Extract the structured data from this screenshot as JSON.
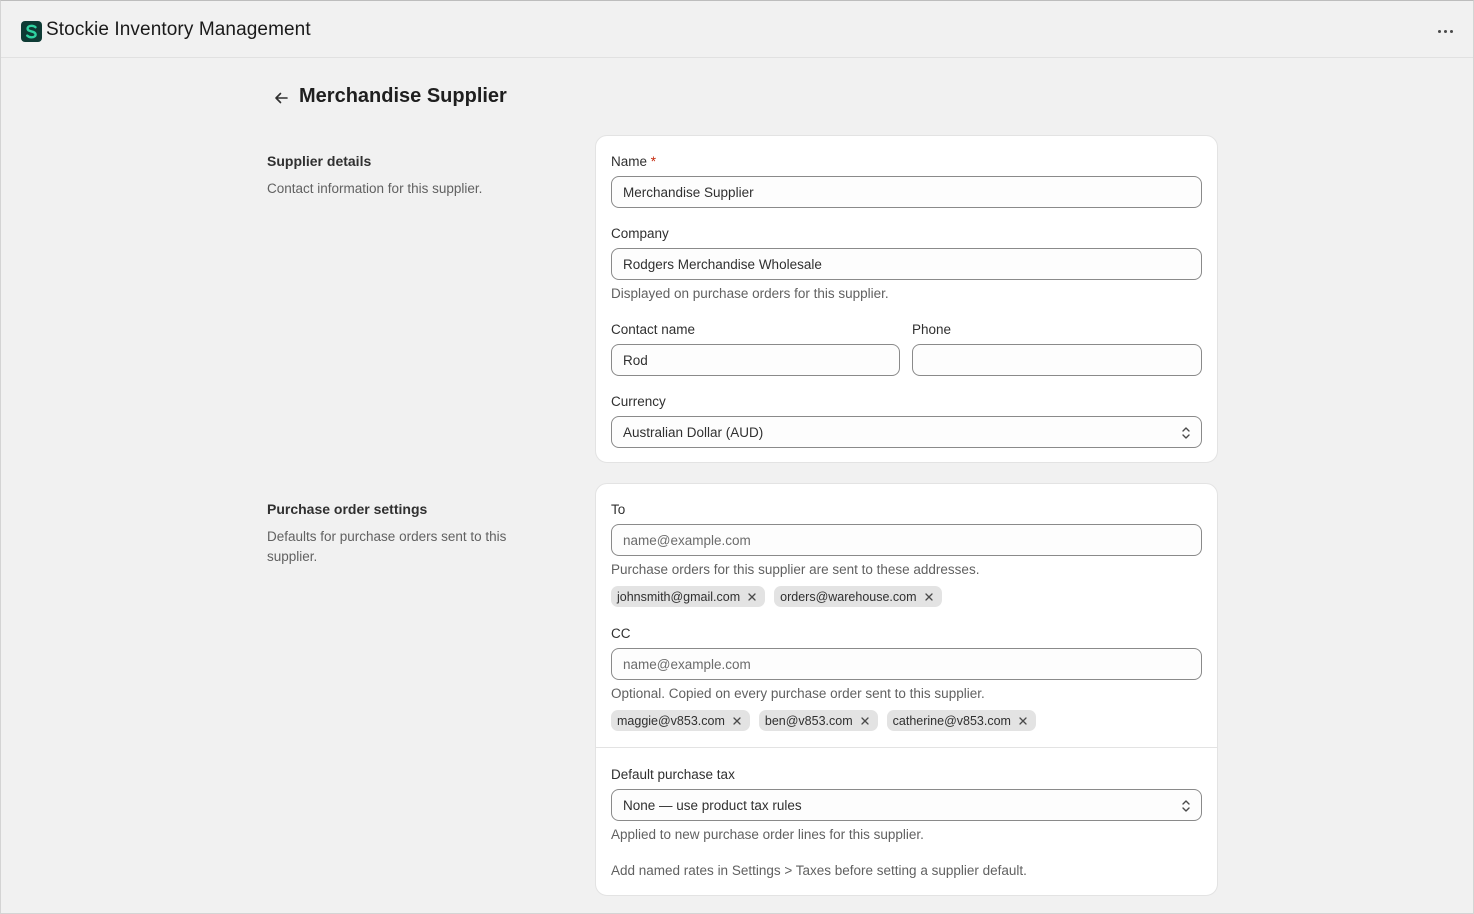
{
  "app": {
    "title": "Stockie Inventory Management",
    "logo_letter": "S",
    "logo_color": "#0e3b35",
    "logo_accent": "#2fd3a2"
  },
  "page": {
    "title": "Merchandise Supplier",
    "back_icon": "arrow-left-icon",
    "menu_icon": "more-horizontal-icon"
  },
  "supplier_details": {
    "title": "Supplier details",
    "description": "Contact information for this supplier.",
    "name": {
      "label": "Name",
      "required_mark": "*",
      "value": "Merchandise Supplier"
    },
    "company": {
      "label": "Company",
      "value": "Rodgers Merchandise Wholesale",
      "help": "Displayed on purchase orders for this supplier."
    },
    "contact_name": {
      "label": "Contact name",
      "value": "Rod"
    },
    "phone": {
      "label": "Phone",
      "value": ""
    },
    "currency": {
      "label": "Currency",
      "value": "Australian Dollar (AUD)"
    }
  },
  "purchase_order_settings": {
    "title": "Purchase order settings",
    "description": "Defaults for purchase orders sent to this supplier.",
    "to": {
      "label": "To",
      "placeholder": "name@example.com",
      "help": "Purchase orders for this supplier are sent to these addresses.",
      "emails": [
        "johnsmith@gmail.com",
        "orders@warehouse.com"
      ]
    },
    "cc": {
      "label": "CC",
      "placeholder": "name@example.com",
      "help": "Optional. Copied on every purchase order sent to this supplier.",
      "emails": [
        "maggie@v853.com",
        "ben@v853.com",
        "catherine@v853.com"
      ]
    },
    "tax": {
      "label": "Default purchase tax",
      "value": "None — use product tax rules",
      "help": "Applied to new purchase order lines for this supplier.",
      "note": "Add named rates in Settings > Taxes before setting a supplier default."
    }
  }
}
